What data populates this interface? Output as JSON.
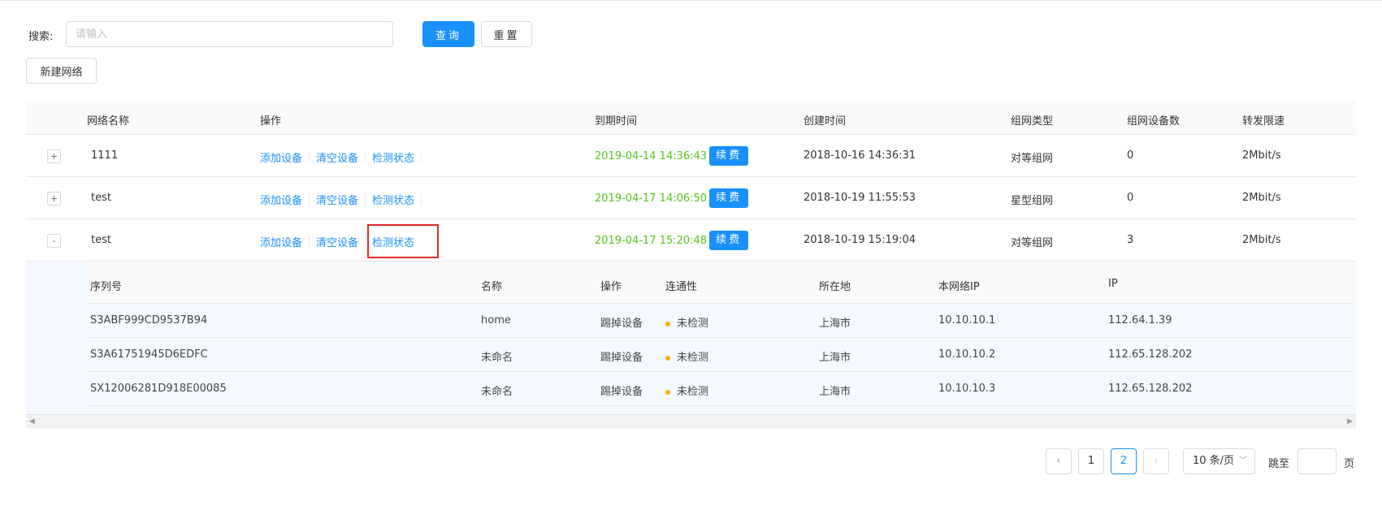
{
  "search": {
    "label": "搜索:",
    "placeholder": "请输入",
    "query_button": "查询",
    "reset_button": "重置",
    "new_network_button": "新建网络"
  },
  "table": {
    "headers": {
      "name": "网络名称",
      "ops": "操作",
      "expire": "到期时间",
      "created": "创建时间",
      "type": "组网类型",
      "device_count": "组网设备数",
      "speed": "转发限速"
    },
    "op_labels": {
      "add": "添加设备",
      "clear": "清空设备",
      "check": "检测状态",
      "renew": "续费"
    },
    "rows": [
      {
        "expander": "+",
        "name": "1111",
        "expire": "2019-04-14 14:36:43",
        "created": "2018-10-16 14:36:31",
        "type": "对等组网",
        "device_count": "0",
        "speed": "2Mbit/s"
      },
      {
        "expander": "+",
        "name": "test",
        "expire": "2019-04-17 14:06:50",
        "created": "2018-10-19 11:55:53",
        "type": "星型组网",
        "device_count": "0",
        "speed": "2Mbit/s"
      },
      {
        "expander": "-",
        "name": "test",
        "expire": "2019-04-17 15:20:48",
        "created": "2018-10-19 15:19:04",
        "type": "对等组网",
        "device_count": "3",
        "speed": "2Mbit/s"
      }
    ]
  },
  "sub_table": {
    "headers": {
      "serial": "序列号",
      "name": "名称",
      "ops": "操作",
      "connectivity": "连通性",
      "location": "所在地",
      "local_ip": "本网络IP",
      "ip": "IP"
    },
    "kick_label": "踢掉设备",
    "rows": [
      {
        "serial": "S3ABF999CD9537B94",
        "name": "home",
        "connectivity": "未检测",
        "location": "上海市",
        "local_ip": "10.10.10.1",
        "ip": "112.64.1.39"
      },
      {
        "serial": "S3A61751945D6EDFC",
        "name": "未命名",
        "connectivity": "未检测",
        "location": "上海市",
        "local_ip": "10.10.10.2",
        "ip": "112.65.128.202"
      },
      {
        "serial": "SX12006281D918E00085",
        "name": "未命名",
        "connectivity": "未检测",
        "location": "上海市",
        "local_ip": "10.10.10.3",
        "ip": "112.65.128.202"
      }
    ]
  },
  "pagination": {
    "prev_icon": "‹",
    "next_icon": "›",
    "pages": [
      "1",
      "2"
    ],
    "current_page": "2",
    "page_size": "10 条/页",
    "jump_label": "跳至",
    "page_suffix": "页"
  },
  "colors": {
    "primary": "#1890ff",
    "expire_green": "#52c41a",
    "highlight_red": "#e12b2b",
    "status_dot": "#faad14"
  }
}
